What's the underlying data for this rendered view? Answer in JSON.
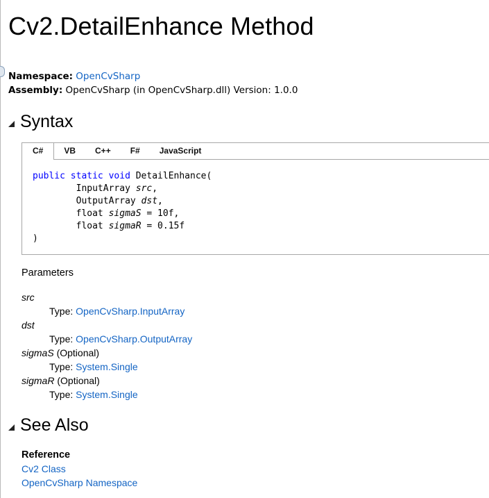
{
  "page": {
    "title": "Cv2.DetailEnhance Method"
  },
  "meta": {
    "namespace_label": "Namespace:",
    "namespace_value": "OpenCvSharp",
    "assembly_label": "Assembly:",
    "assembly_value": "OpenCvSharp (in OpenCvSharp.dll) Version: 1.0.0"
  },
  "syntax": {
    "heading": "Syntax",
    "tabs": [
      "C#",
      "VB",
      "C++",
      "F#",
      "JavaScript"
    ],
    "active_tab": "C#",
    "code": {
      "kw1": "public",
      "kw2": "static",
      "kw3": "void",
      "method": "DetailEnhance(",
      "p1_type": "InputArray",
      "p1_name": "src",
      "p2_type": "OutputArray",
      "p2_name": "dst",
      "p3_type": "float",
      "p3_name": "sigmaS",
      "p3_default": "= 10f,",
      "p4_type": "float",
      "p4_name": "sigmaR",
      "p4_default": "= 0.15f",
      "close": ")"
    }
  },
  "parameters": {
    "heading": "Parameters",
    "type_label": "Type:",
    "items": [
      {
        "name": "src",
        "optional": "",
        "type": "OpenCvSharp.InputArray"
      },
      {
        "name": "dst",
        "optional": "",
        "type": "OpenCvSharp.OutputArray"
      },
      {
        "name": "sigmaS",
        "optional": "(Optional)",
        "type": "System.Single"
      },
      {
        "name": "sigmaR",
        "optional": "(Optional)",
        "type": "System.Single"
      }
    ]
  },
  "see_also": {
    "heading": "See Also",
    "subheading": "Reference",
    "links": [
      "Cv2 Class",
      "OpenCvSharp Namespace"
    ]
  },
  "colors": {
    "link": "#1364c4",
    "keyword": "#0000ff"
  }
}
